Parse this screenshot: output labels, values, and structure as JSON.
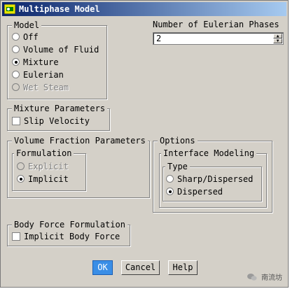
{
  "window": {
    "title": "Multiphase Model"
  },
  "model": {
    "label": "Model",
    "options": [
      {
        "label": "Off",
        "checked": false,
        "enabled": true
      },
      {
        "label": "Volume of Fluid",
        "checked": false,
        "enabled": true
      },
      {
        "label": "Mixture",
        "checked": true,
        "enabled": true
      },
      {
        "label": "Eulerian",
        "checked": false,
        "enabled": true
      },
      {
        "label": "Wet Steam",
        "checked": false,
        "enabled": false
      }
    ]
  },
  "phases": {
    "label": "Number of Eulerian Phases",
    "value": "2"
  },
  "mixture_parameters": {
    "label": "Mixture Parameters",
    "slip_velocity": {
      "label": "Slip Velocity",
      "checked": false
    }
  },
  "volume_fraction": {
    "label": "Volume Fraction Parameters",
    "formulation": {
      "label": "Formulation",
      "options": [
        {
          "label": "Explicit",
          "checked": false,
          "enabled": false
        },
        {
          "label": "Implicit",
          "checked": true,
          "enabled": true
        }
      ]
    }
  },
  "options": {
    "label": "Options",
    "interface_modeling": {
      "label": "Interface Modeling",
      "type": {
        "label": "Type",
        "options": [
          {
            "label": "Sharp/Dispersed",
            "checked": false
          },
          {
            "label": "Dispersed",
            "checked": true
          }
        ]
      }
    }
  },
  "body_force": {
    "label": "Body Force Formulation",
    "implicit_body_force": {
      "label": "Implicit Body Force",
      "checked": false
    }
  },
  "buttons": {
    "ok": "OK",
    "cancel": "Cancel",
    "help": "Help"
  },
  "watermark": {
    "text": "南流坊"
  }
}
